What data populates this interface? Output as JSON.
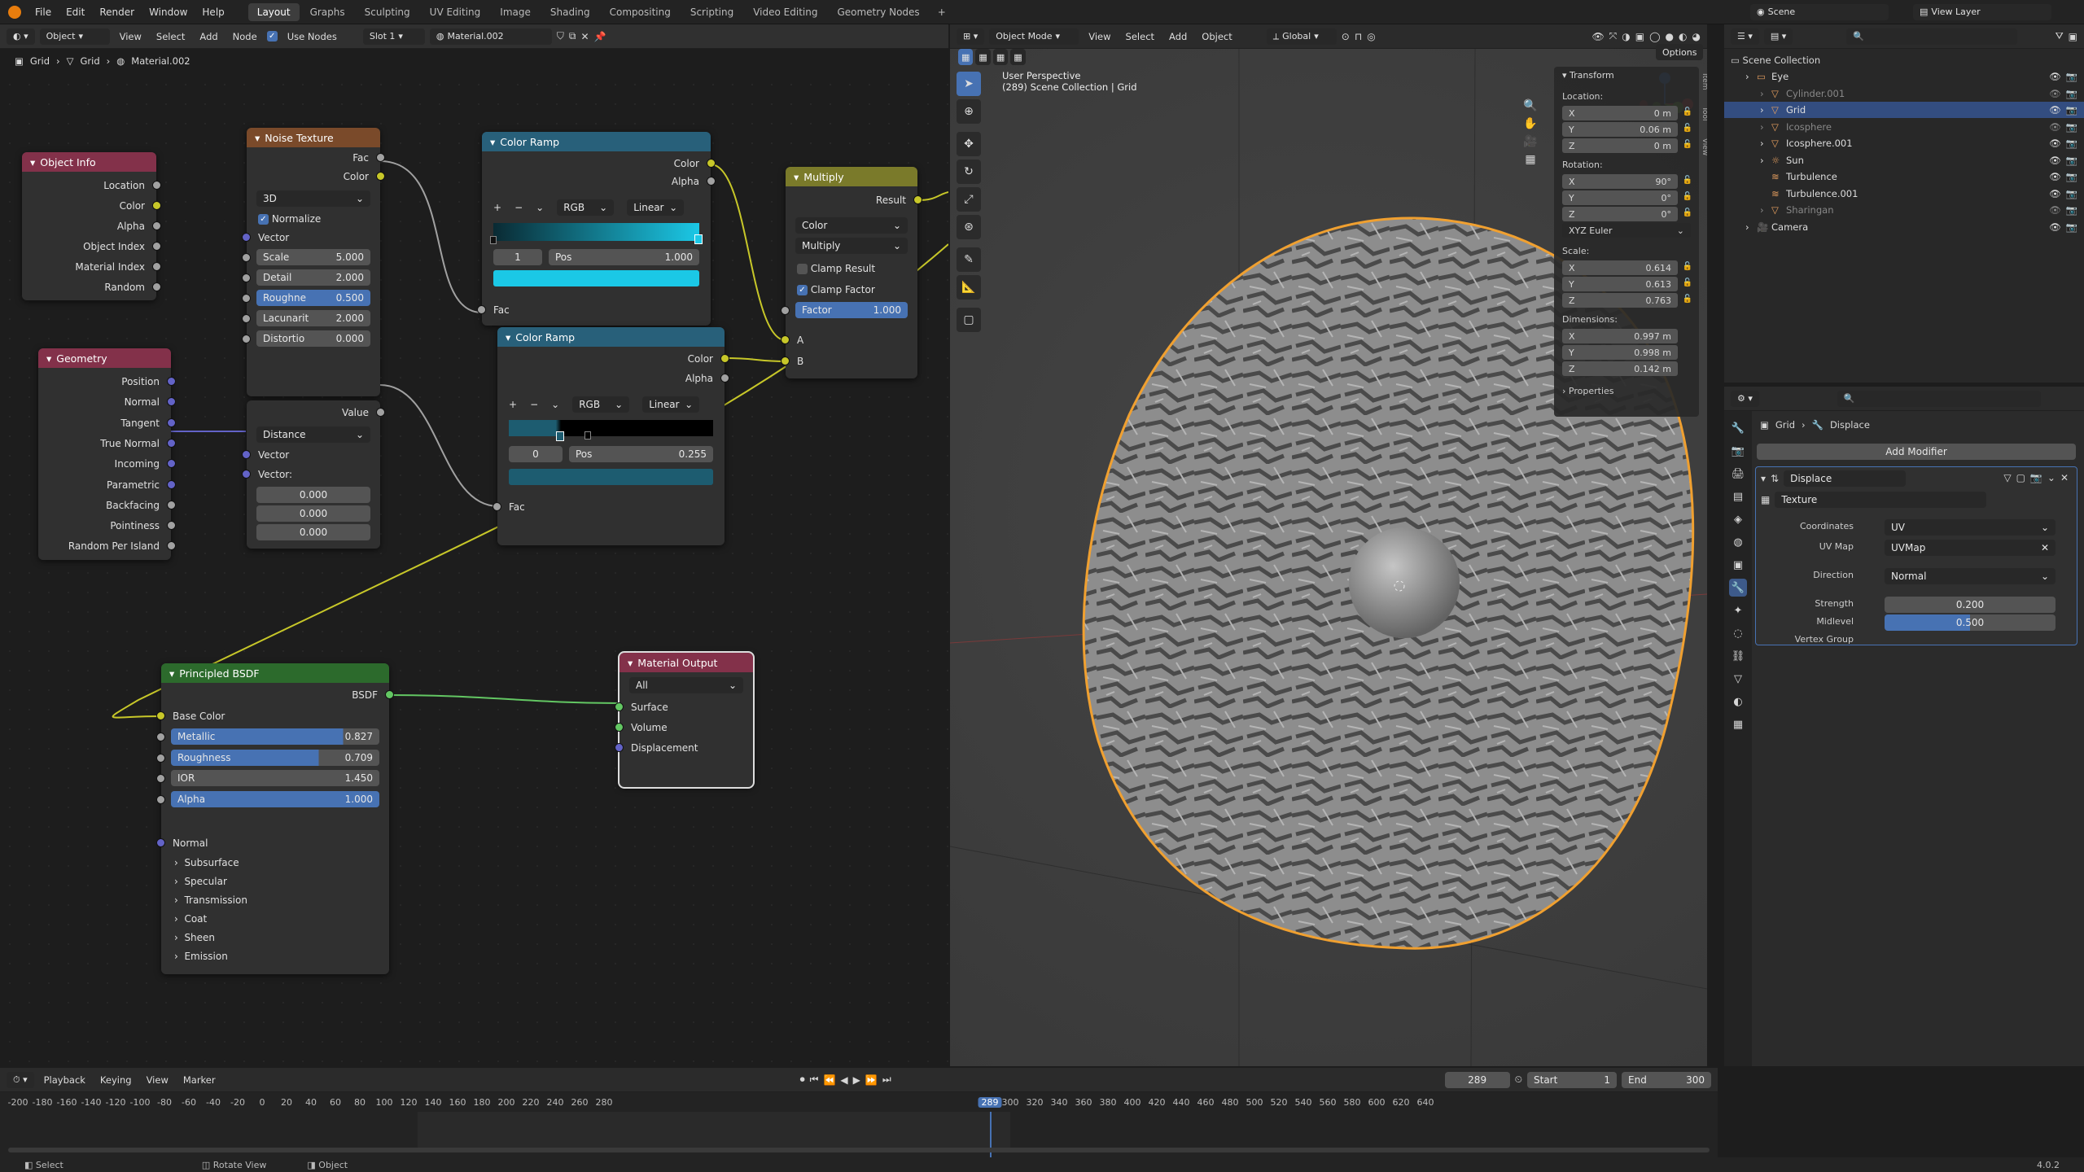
{
  "menu": [
    "File",
    "Edit",
    "Render",
    "Window",
    "Help"
  ],
  "workspaces": [
    "Layout",
    "Graphs",
    "Sculpting",
    "UV Editing",
    "Image",
    "Shading",
    "Compositing",
    "Scripting",
    "Video Editing",
    "Geometry Nodes"
  ],
  "active_ws": "Layout",
  "scene": "Scene",
  "view_layer": "View Layer",
  "ne": {
    "object": "Object",
    "view": "View",
    "select": "Select",
    "add": "Add",
    "node": "Node",
    "use_nodes": "Use Nodes",
    "slot": "Slot 1",
    "material": "Material.002",
    "bc": [
      "Grid",
      "Grid",
      "Material.002"
    ]
  },
  "nodes": {
    "obj_info": {
      "title": "Object Info",
      "outs": [
        "Location",
        "Color",
        "Alpha",
        "Object Index",
        "Material Index",
        "Random"
      ]
    },
    "geometry": {
      "title": "Geometry",
      "outs": [
        "Position",
        "Normal",
        "Tangent",
        "True Normal",
        "Incoming",
        "Parametric",
        "Backfacing",
        "Pointiness",
        "Random Per Island"
      ]
    },
    "noise": {
      "title": "Noise Texture",
      "fac": "Fac",
      "color": "Color",
      "dim": "3D",
      "normalize": "Normalize",
      "vector": "Vector",
      "fields": [
        {
          "l": "Scale",
          "v": "5.000"
        },
        {
          "l": "Detail",
          "v": "2.000"
        },
        {
          "l": "Roughne",
          "v": "0.500"
        },
        {
          "l": "Lacunarit",
          "v": "2.000"
        },
        {
          "l": "Distortio",
          "v": "0.000"
        }
      ]
    },
    "voronoi": {
      "value": "Value",
      "mode": "Distance",
      "vector": "Vector",
      "vector2": "Vector:",
      "vals": [
        "0.000",
        "0.000",
        "0.000"
      ]
    },
    "ramp1": {
      "title": "Color Ramp",
      "color": "Color",
      "alpha": "Alpha",
      "mode": "RGB",
      "interp": "Linear",
      "idx": "1",
      "pos_l": "Pos",
      "pos": "1.000",
      "fac": "Fac"
    },
    "ramp2": {
      "title": "Color Ramp",
      "color": "Color",
      "alpha": "Alpha",
      "mode": "RGB",
      "interp": "Linear",
      "idx": "0",
      "pos_l": "Pos",
      "pos": "0.255",
      "fac": "Fac"
    },
    "multiply": {
      "title": "Multiply",
      "result": "Result",
      "type": "Color",
      "op": "Multiply",
      "clamp_result": "Clamp Result",
      "clamp_factor": "Clamp Factor",
      "factor_l": "Factor",
      "factor": "1.000",
      "a": "A",
      "b": "B"
    },
    "bsdf": {
      "title": "Principled BSDF",
      "out": "BSDF",
      "base": "Base Color",
      "fields": [
        {
          "l": "Metallic",
          "v": "0.827",
          "p": 0.827
        },
        {
          "l": "Roughness",
          "v": "0.709",
          "p": 0.709
        },
        {
          "l": "IOR",
          "v": "1.450",
          "p": 0
        },
        {
          "l": "Alpha",
          "v": "1.000",
          "p": 1
        }
      ],
      "normal": "Normal",
      "panels": [
        "Subsurface",
        "Specular",
        "Transmission",
        "Coat",
        "Sheen",
        "Emission"
      ]
    },
    "output": {
      "title": "Material Output",
      "target": "All",
      "ins": [
        "Surface",
        "Volume",
        "Displacement"
      ]
    }
  },
  "vp": {
    "mode": "Object Mode",
    "view": "View",
    "select": "Select",
    "add": "Add",
    "object": "Object",
    "orient": "Global",
    "options": "Options",
    "persp": "User Perspective",
    "coll": "(289) Scene Collection | Grid"
  },
  "transform": {
    "title": "Transform",
    "loc_l": "Location:",
    "loc": [
      [
        "X",
        "0 m"
      ],
      [
        "Y",
        "0.06 m"
      ],
      [
        "Z",
        "0 m"
      ]
    ],
    "rot_l": "Rotation:",
    "rot": [
      [
        "X",
        "90°"
      ],
      [
        "Y",
        "0°"
      ],
      [
        "Z",
        "0°"
      ]
    ],
    "euler": "XYZ Euler",
    "scale_l": "Scale:",
    "scale": [
      [
        "X",
        "0.614"
      ],
      [
        "Y",
        "0.613"
      ],
      [
        "Z",
        "0.763"
      ]
    ],
    "dim_l": "Dimensions:",
    "dim": [
      [
        "X",
        "0.997 m"
      ],
      [
        "Y",
        "0.998 m"
      ],
      [
        "Z",
        "0.142 m"
      ]
    ],
    "props": "Properties"
  },
  "npanel_tabs": [
    "Item",
    "Tool",
    "View"
  ],
  "outliner": {
    "root": "Scene Collection",
    "items": [
      {
        "n": "Eye",
        "d": 1,
        "t": "col"
      },
      {
        "n": "Cylinder.001",
        "d": 2,
        "t": "mesh",
        "dim": true
      },
      {
        "n": "Grid",
        "d": 2,
        "t": "mesh",
        "sel": true
      },
      {
        "n": "Icosphere",
        "d": 2,
        "t": "mesh",
        "dim": true
      },
      {
        "n": "Icosphere.001",
        "d": 2,
        "t": "mesh"
      },
      {
        "n": "Sun",
        "d": 2,
        "t": "light"
      },
      {
        "n": "Turbulence",
        "d": 2,
        "t": "force"
      },
      {
        "n": "Turbulence.001",
        "d": 2,
        "t": "force"
      },
      {
        "n": "Sharingan",
        "d": 2,
        "t": "mesh",
        "dim": true
      },
      {
        "n": "Camera",
        "d": 1,
        "t": "cam"
      }
    ]
  },
  "modifier": {
    "bc": [
      "Grid",
      "Displace"
    ],
    "add": "Add Modifier",
    "name": "Displace",
    "texture": "Texture",
    "coords_l": "Coordinates",
    "coords": "UV",
    "uvmap_l": "UV Map",
    "uvmap": "UVMap",
    "dir_l": "Direction",
    "dir": "Normal",
    "strength_l": "Strength",
    "strength": "0.200",
    "mid_l": "Midlevel",
    "mid": "0.500",
    "vg_l": "Vertex Group"
  },
  "tl": {
    "playback": "Playback",
    "keying": "Keying",
    "view": "View",
    "marker": "Marker",
    "frame": "289",
    "start_l": "Start",
    "start": "1",
    "end_l": "End",
    "end": "300",
    "ticks": [
      "-200",
      "-180",
      "-160",
      "-140",
      "-120",
      "-100",
      "-80",
      "-60",
      "-40",
      "-20",
      "0",
      "20",
      "40",
      "60",
      "80",
      "100",
      "120",
      "140",
      "160",
      "180",
      "200",
      "220",
      "240",
      "260",
      "280",
      "289",
      "300",
      "320",
      "340",
      "360",
      "380",
      "400",
      "420",
      "440",
      "460",
      "480",
      "500",
      "520",
      "540",
      "560",
      "580",
      "600",
      "620",
      "640"
    ]
  },
  "status": {
    "select": "Select",
    "rotate": "Rotate View",
    "object": "Object",
    "version": "4.0.2"
  }
}
